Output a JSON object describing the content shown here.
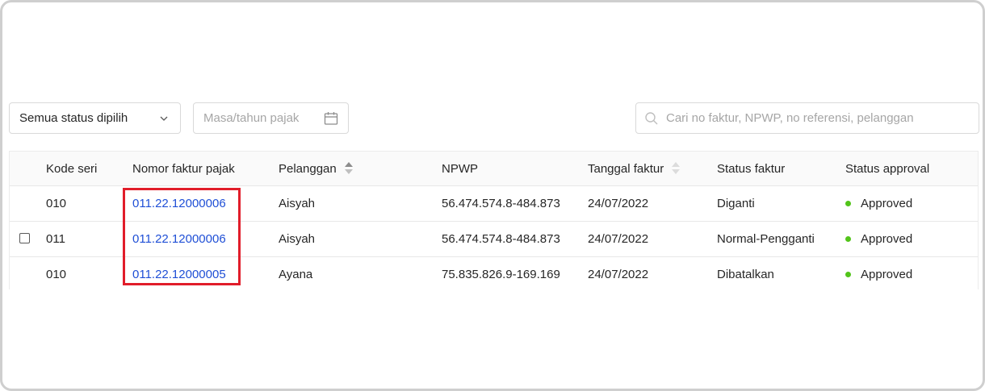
{
  "filters": {
    "status_select_value": "Semua status dipilih",
    "period_placeholder": "Masa/tahun pajak",
    "search_placeholder": "Cari no faktur, NPWP, no referensi, pelanggan"
  },
  "table": {
    "columns": {
      "kode_seri": "Kode seri",
      "nomor_faktur": "Nomor faktur pajak",
      "pelanggan": "Pelanggan",
      "npwp": "NPWP",
      "tanggal_faktur": "Tanggal faktur",
      "status_faktur": "Status faktur",
      "status_approval": "Status approval"
    },
    "rows": [
      {
        "kode_seri": "010",
        "nomor_faktur": "011.22.12000006",
        "pelanggan": "Aisyah",
        "npwp": "56.474.574.8-484.873",
        "tanggal_faktur": "24/07/2022",
        "status_faktur": "Diganti",
        "status_approval": "Approved",
        "has_checkbox": false
      },
      {
        "kode_seri": "011",
        "nomor_faktur": "011.22.12000006",
        "pelanggan": "Aisyah",
        "npwp": "56.474.574.8-484.873",
        "tanggal_faktur": "24/07/2022",
        "status_faktur": "Normal-Pengganti",
        "status_approval": "Approved",
        "has_checkbox": true
      },
      {
        "kode_seri": "010",
        "nomor_faktur": "011.22.12000005",
        "pelanggan": "Ayana",
        "npwp": "75.835.826.9-169.169",
        "tanggal_faktur": "24/07/2022",
        "status_faktur": "Dibatalkan",
        "status_approval": "Approved",
        "has_checkbox": false
      }
    ]
  },
  "icons": {
    "select": "chevron-down-icon",
    "period": "calendar-icon",
    "search": "search-icon",
    "sort": "sort-icon",
    "approval": "status-dot-icon"
  },
  "colors": {
    "link": "#1f4fd6",
    "approved": "#52c41a",
    "highlight": "#e11d2a"
  }
}
